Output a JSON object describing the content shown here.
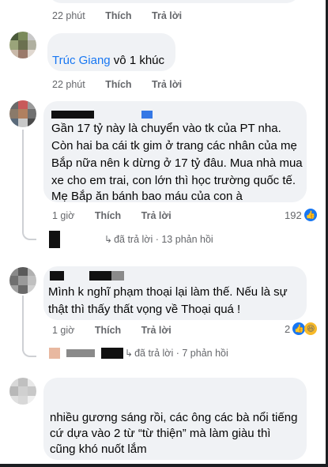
{
  "top_meta": {
    "time": "22 phút",
    "like": "Thích",
    "reply": "Trả lời"
  },
  "comment1": {
    "author": "Trúc Giang",
    "text": " vô 1 khúc",
    "time": "22 phút",
    "like": "Thích",
    "reply": "Trả lời"
  },
  "comment2": {
    "lines": [
      "Gần 17 tỷ này là chuyển vào tk của PT nha.",
      "Còn hai ba cái tk gim ở trang các nhân của mẹ",
      "Bắp nữa nên k dừng ở 17 tỷ đâu. Mua nhà mua",
      "xe cho em trai, con lớn thì học trường quốc tế.",
      "Mẹ Bắp ăn bánh bao máu của con à"
    ],
    "time": "1 giờ",
    "like": "Thích",
    "reply": "Trả lời",
    "reactions": "192",
    "reply_summary": "đã trả lời · 13 phản hồi"
  },
  "comment3": {
    "lines": [
      "Mình k nghĩ phạm thoại lại làm thế. Nếu là sự",
      "thật thì thấy thất vọng về Thoại quá !"
    ],
    "time": "1 giờ",
    "like": "Thích",
    "reply": "Trả lời",
    "reactions": "2",
    "reply_summary": "đã trả lời · 7 phản hồi"
  },
  "comment4": {
    "lines": [
      "nhiều gương sáng rồi, các ông các bà nổi tiếng",
      "cứ dựa vào 2 từ “từ thiện” mà làm giàu thì",
      "cũng khó nuốt lắm"
    ]
  },
  "colors": {
    "link": "#1877f2",
    "bubble": "#f0f2f5",
    "meta": "#65676b"
  }
}
